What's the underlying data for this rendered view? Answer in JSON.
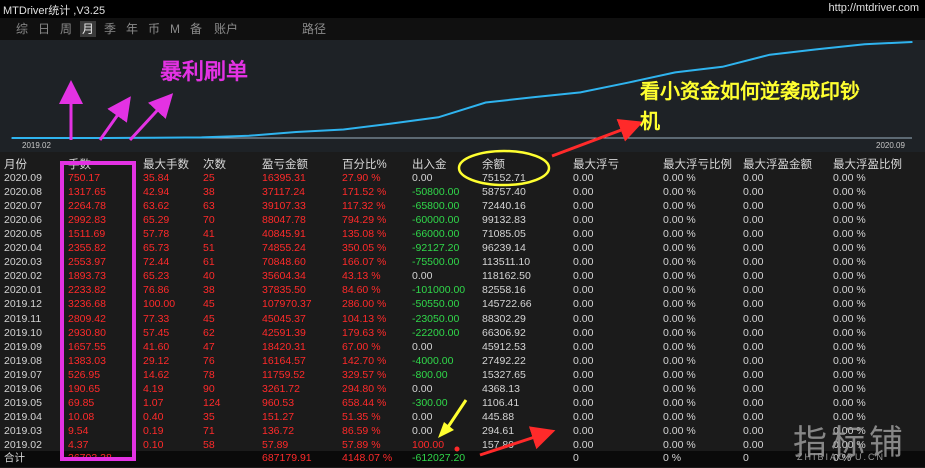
{
  "app": {
    "title": "MTDriver统计 ,V3.25",
    "url": "http://mtdriver.com"
  },
  "period_tabs": [
    "综",
    "日",
    "周",
    "月",
    "季",
    "年",
    "币",
    "M",
    "备",
    "账户",
    "路径"
  ],
  "active_tab": "月",
  "chart": {
    "start_label": "2019.02",
    "end_label": "2020.09",
    "line_color": "#2fb4ef"
  },
  "chart_data": {
    "type": "line",
    "x": [
      "2019.02",
      "2019.03",
      "2019.04",
      "2019.05",
      "2019.06",
      "2019.07",
      "2019.08",
      "2019.09",
      "2019.10",
      "2019.11",
      "2019.12",
      "2020.01",
      "2020.02",
      "2020.03",
      "2020.04",
      "2020.05",
      "2020.06",
      "2020.07",
      "2020.08",
      "2020.09"
    ],
    "series": [
      {
        "values": [
          57.89,
          194.61,
          345.87,
          1306.4,
          4568.12,
          16327.77,
          43805.34,
          62225.65,
          104817.04,
          150862.41,
          258832.78,
          296668.28,
          332272.62,
          403113.22,
          478082.98,
          518924.16,
          606972.18,
          646129.49,
          683246.64,
          699641.95
        ]
      }
    ]
  },
  "table": {
    "headers": [
      "月份",
      "手数",
      "最大手数",
      "次数",
      "盈亏金额",
      "百分比%",
      "出入金",
      "余额",
      "最大浮亏",
      "最大浮亏比例",
      "最大浮盈金额",
      "最大浮盈比例"
    ],
    "rows": [
      [
        "2020.09",
        "750.17",
        "35.84",
        "25",
        "16395.31",
        "27.90 %",
        "0.00",
        "75152.71",
        "0.00",
        "0.00 %",
        "0.00",
        "0.00 %"
      ],
      [
        "2020.08",
        "1317.65",
        "42.94",
        "38",
        "37117.24",
        "171.52 %",
        "-50800.00",
        "58757.40",
        "0.00",
        "0.00 %",
        "0.00",
        "0.00 %"
      ],
      [
        "2020.07",
        "2264.78",
        "63.62",
        "63",
        "39107.33",
        "117.32 %",
        "-65800.00",
        "72440.16",
        "0.00",
        "0.00 %",
        "0.00",
        "0.00 %"
      ],
      [
        "2020.06",
        "2992.83",
        "65.29",
        "70",
        "88047.78",
        "794.29 %",
        "-60000.00",
        "99132.83",
        "0.00",
        "0.00 %",
        "0.00",
        "0.00 %"
      ],
      [
        "2020.05",
        "1511.69",
        "57.78",
        "41",
        "40845.91",
        "135.08 %",
        "-66000.00",
        "71085.05",
        "0.00",
        "0.00 %",
        "0.00",
        "0.00 %"
      ],
      [
        "2020.04",
        "2355.82",
        "65.73",
        "51",
        "74855.24",
        "350.05 %",
        "-92127.20",
        "96239.14",
        "0.00",
        "0.00 %",
        "0.00",
        "0.00 %"
      ],
      [
        "2020.03",
        "2553.97",
        "72.44",
        "61",
        "70848.60",
        "166.07 %",
        "-75500.00",
        "113511.10",
        "0.00",
        "0.00 %",
        "0.00",
        "0.00 %"
      ],
      [
        "2020.02",
        "1893.73",
        "65.23",
        "40",
        "35604.34",
        "43.13 %",
        "0.00",
        "118162.50",
        "0.00",
        "0.00 %",
        "0.00",
        "0.00 %"
      ],
      [
        "2020.01",
        "2233.82",
        "76.86",
        "38",
        "37835.50",
        "84.60 %",
        "-101000.00",
        "82558.16",
        "0.00",
        "0.00 %",
        "0.00",
        "0.00 %"
      ],
      [
        "2019.12",
        "3236.68",
        "100.00",
        "45",
        "107970.37",
        "286.00 %",
        "-50550.00",
        "145722.66",
        "0.00",
        "0.00 %",
        "0.00",
        "0.00 %"
      ],
      [
        "2019.11",
        "2809.42",
        "77.33",
        "45",
        "45045.37",
        "104.13 %",
        "-23050.00",
        "88302.29",
        "0.00",
        "0.00 %",
        "0.00",
        "0.00 %"
      ],
      [
        "2019.10",
        "2930.80",
        "57.45",
        "62",
        "42591.39",
        "179.63 %",
        "-22200.00",
        "66306.92",
        "0.00",
        "0.00 %",
        "0.00",
        "0.00 %"
      ],
      [
        "2019.09",
        "1657.55",
        "41.60",
        "47",
        "18420.31",
        "67.00 %",
        "0.00",
        "45912.53",
        "0.00",
        "0.00 %",
        "0.00",
        "0.00 %"
      ],
      [
        "2019.08",
        "1383.03",
        "29.12",
        "76",
        "16164.57",
        "142.70 %",
        "-4000.00",
        "27492.22",
        "0.00",
        "0.00 %",
        "0.00",
        "0.00 %"
      ],
      [
        "2019.07",
        "526.95",
        "14.62",
        "78",
        "11759.52",
        "329.57 %",
        "-800.00",
        "15327.65",
        "0.00",
        "0.00 %",
        "0.00",
        "0.00 %"
      ],
      [
        "2019.06",
        "190.65",
        "4.19",
        "90",
        "3261.72",
        "294.80 %",
        "0.00",
        "4368.13",
        "0.00",
        "0.00 %",
        "0.00",
        "0.00 %"
      ],
      [
        "2019.05",
        "69.85",
        "1.07",
        "124",
        "960.53",
        "658.44 %",
        "-300.00",
        "1106.41",
        "0.00",
        "0.00 %",
        "0.00",
        "0.00 %"
      ],
      [
        "2019.04",
        "10.08",
        "0.40",
        "35",
        "151.27",
        "51.35 %",
        "0.00",
        "445.88",
        "0.00",
        "0.00 %",
        "0.00",
        "0.00 %"
      ],
      [
        "2019.03",
        "9.54",
        "0.19",
        "71",
        "136.72",
        "86.59 %",
        "0.00",
        "294.61",
        "0.00",
        "0.00 %",
        "0.00",
        "0.00 %"
      ],
      [
        "2019.02",
        "4.37",
        "0.10",
        "58",
        "57.89",
        "57.89 %",
        "100.00",
        "157.89",
        "0.00",
        "0.00 %",
        "0.00",
        "0.00 %"
      ]
    ],
    "totals": [
      "合计",
      "36703.38",
      "",
      "",
      "687179.91",
      "4148.07 %",
      "-612027.20",
      "",
      "0",
      "0 %",
      "0",
      "0 %"
    ]
  },
  "annotations": {
    "baoli": "暴利刷单",
    "xiaozijin_line1": "看小资金如何逆袭成印钞",
    "xiaozijin_line2": "机"
  },
  "watermark": {
    "main": "指标铺",
    "sub": "ZHIBIAOPU.CN"
  },
  "colors": {
    "annotation_magenta": "#e332e3",
    "annotation_yellow": "#ffff30",
    "arrow_red": "#ff2a2a",
    "positive": "#30d84a",
    "negative": "#ff2a2a"
  }
}
